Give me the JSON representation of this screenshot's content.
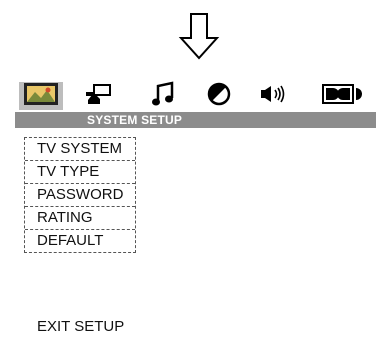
{
  "header": {
    "arrow_icon": "down-arrow-icon"
  },
  "tabs": [
    {
      "icon": "tv-screen-icon",
      "active": true
    },
    {
      "icon": "speaker-audio-icon",
      "active": false
    },
    {
      "icon": "music-note-icon",
      "active": false
    },
    {
      "icon": "contrast-icon",
      "active": false
    },
    {
      "icon": "sound-wave-icon",
      "active": false
    },
    {
      "icon": "dolby-icon",
      "active": false
    }
  ],
  "title": "SYSTEM SETUP",
  "menu": {
    "items": [
      {
        "label": "TV SYSTEM"
      },
      {
        "label": "TV TYPE"
      },
      {
        "label": "PASSWORD"
      },
      {
        "label": "RATING"
      },
      {
        "label": "DEFAULT"
      }
    ]
  },
  "exit_label": "EXIT SETUP",
  "colors": {
    "title_bar": "#8c8c8c",
    "active_tab": "#bdbdbd",
    "text": "#111111"
  }
}
